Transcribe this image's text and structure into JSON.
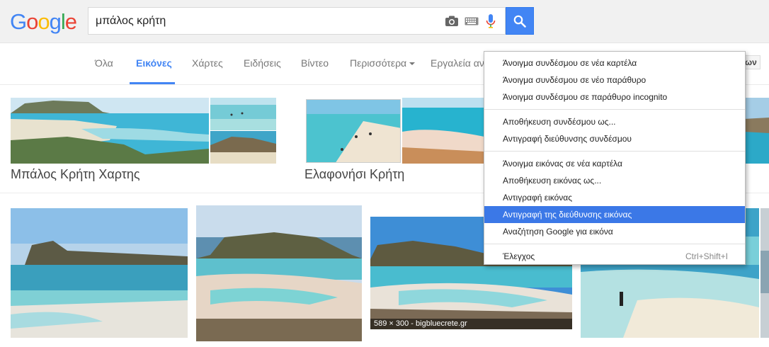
{
  "logo": {
    "letters": [
      "G",
      "o",
      "o",
      "g",
      "l",
      "e"
    ],
    "colors": [
      "#4285f4",
      "#ea4335",
      "#fbbc05",
      "#4285f4",
      "#34a853",
      "#ea4335"
    ]
  },
  "search": {
    "query": "μπάλος κρήτη"
  },
  "tabs": [
    {
      "label": "Όλα"
    },
    {
      "label": "Εικόνες"
    },
    {
      "label": "Χάρτες"
    },
    {
      "label": "Ειδήσεις"
    },
    {
      "label": "Βίντεο"
    },
    {
      "label": "Περισσότερα"
    },
    {
      "label": "Εργαλεία αν"
    }
  ],
  "tools_partial": "ων",
  "related": [
    {
      "title": "Μπάλος Κρήτη Χαρτης"
    },
    {
      "title": "Ελαφονήσι Κρήτη"
    }
  ],
  "results": [
    {
      "caption": "589 × 300 - bigbluecrete.gr"
    }
  ],
  "context_menu": {
    "groups": [
      [
        {
          "label": "Άνοιγμα συνδέσμου σε νέα καρτέλα"
        },
        {
          "label": "Άνοιγμα συνδέσμου σε νέο παράθυρο"
        },
        {
          "label": "Άνοιγμα συνδέσμου σε παράθυρο incognito"
        }
      ],
      [
        {
          "label": "Αποθήκευση συνδέσμου ως..."
        },
        {
          "label": "Αντιγραφή διεύθυνσης συνδέσμου"
        }
      ],
      [
        {
          "label": "Άνοιγμα εικόνας σε νέα καρτέλα"
        },
        {
          "label": "Αποθήκευση εικόνας ως..."
        },
        {
          "label": "Αντιγραφή εικόνας"
        },
        {
          "label": "Αντιγραφή της διεύθυνσης εικόνας",
          "highlighted": true
        },
        {
          "label": "Αναζήτηση Google για εικόνα"
        }
      ],
      [
        {
          "label": "Έλεγχος",
          "shortcut": "Ctrl+Shift+I"
        }
      ]
    ]
  },
  "colors": {
    "accent": "#4285f4",
    "menu_highlight": "#3b78e7"
  }
}
